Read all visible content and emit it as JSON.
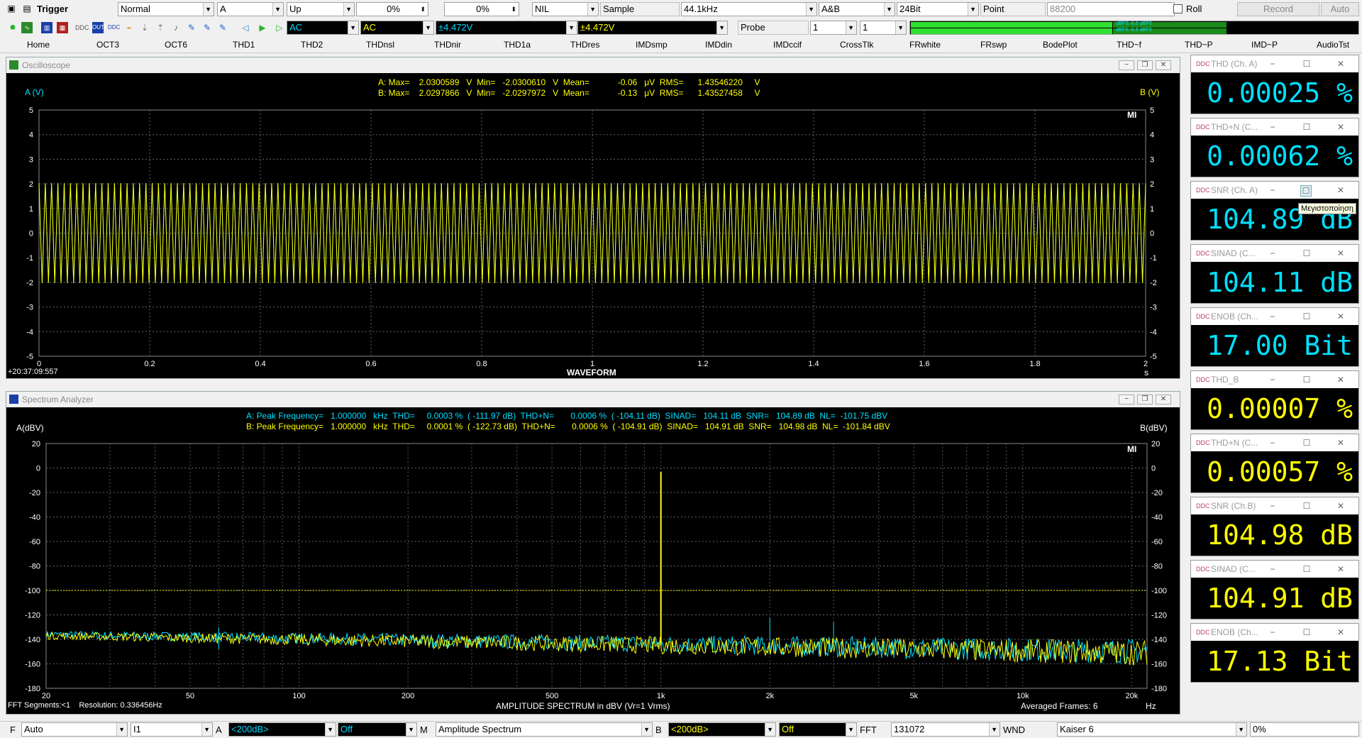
{
  "toolbar1": {
    "trigger_label": "Trigger",
    "mode": "Normal",
    "channel": "A",
    "edge": "Up",
    "level1": "0%",
    "level2": "0%",
    "nil": "NIL",
    "sample_label": "Sample",
    "sample_rate": "44.1kHz",
    "ab": "A&B",
    "bits": "24Bit",
    "point_label": "Point",
    "point_value": "88200",
    "roll_label": "Roll",
    "record_label": "Record",
    "auto_label": "Auto"
  },
  "toolbar2": {
    "coupling_a": "AC",
    "coupling_b": "AC",
    "range_a": "±4.472V",
    "range_b": "±4.472V",
    "probe_label": "Probe",
    "probe_a": "1",
    "probe_b": "1",
    "level_meter_text": "dBFS:-6.6 dBFS\ndBFS:-6.6 dBFS"
  },
  "tabs": [
    "Home",
    "OCT3",
    "OCT6",
    "THD1",
    "THD2",
    "THDnsl",
    "THDnir",
    "THD1a",
    "THDres",
    "IMDsmp",
    "IMDdin",
    "IMDccif",
    "CrossTlk",
    "FRwhite",
    "FRswp",
    "BodePlot",
    "THD~f",
    "THD~P",
    "IMD~P",
    "AudioTst"
  ],
  "oscilloscope": {
    "title": "Oscilloscope",
    "left_axis_label": "A (V)",
    "right_axis_label": "B (V)",
    "meas_a": "A: Max=    2.0300589   V  Min=   -2.0300610   V  Mean=            -0.06   μV  RMS=      1.43546220     V",
    "meas_b": "B: Max=    2.0297866   V  Min=   -2.0297972   V  Mean=            -0.13   μV  RMS=      1.43527458     V",
    "timestamp": "+20:37:09:557",
    "x_caption": "WAVEFORM",
    "x_unit": "s",
    "corner_mark": "MI",
    "y_ticks": [
      "5",
      "4",
      "3",
      "2",
      "1",
      "0",
      "-1",
      "-2",
      "-3",
      "-4",
      "-5"
    ],
    "x_ticks": [
      "0",
      "0.2",
      "0.4",
      "0.6",
      "0.8",
      "1",
      "1.2",
      "1.4",
      "1.6",
      "1.8",
      "2"
    ]
  },
  "spectrum": {
    "title": "Spectrum Analyzer",
    "left_axis_label": "A(dBV)",
    "right_axis_label": "B(dBV)",
    "meas_a": "A: Peak Frequency=   1.000000   kHz  THD=     0.0003 %  ( -111.97 dB)  THD+N=       0.0006 %  ( -104.11 dB)  SINAD=   104.11 dB  SNR=   104.89 dB  NL=  -101.75 dBV",
    "meas_b": "B: Peak Frequency=   1.000000   kHz  THD=     0.0001 %  ( -122.73 dB)  THD+N=       0.0006 %  ( -104.91 dB)  SINAD=   104.91 dB  SNR=   104.98 dB  NL=  -101.84 dBV",
    "footer_left": "FFT Segments:<1    Resolution: 0.336456Hz",
    "footer_center": "AMPLITUDE SPECTRUM in dBV (Vr=1 Vrms)",
    "footer_right": "Averaged Frames: 6",
    "x_unit": "Hz",
    "corner_mark": "MI",
    "y_ticks": [
      "20",
      "0",
      "-20",
      "-40",
      "-60",
      "-80",
      "-100",
      "-120",
      "-140",
      "-160",
      "-180"
    ],
    "x_ticks": [
      "20",
      "50",
      "100",
      "200",
      "500",
      "1k",
      "2k",
      "5k",
      "10k",
      "20k"
    ]
  },
  "meters": [
    {
      "title": "THD (Ch. A)",
      "value": "0.00025 %",
      "color": "#00e0ff"
    },
    {
      "title": "THD+N (C...",
      "value": "0.00062 %",
      "color": "#00e0ff"
    },
    {
      "title": "SNR (Ch. A)",
      "value": "104.89 dB",
      "color": "#00e0ff"
    },
    {
      "title": "SINAD (C...",
      "value": "104.11 dB",
      "color": "#00e0ff"
    },
    {
      "title": "ENOB (Ch...",
      "value": "17.00 Bit",
      "color": "#00e0ff"
    },
    {
      "title": "THD_B",
      "value": "0.00007 %",
      "color": "#ffff00"
    },
    {
      "title": "THD+N (C...",
      "value": "0.00057 %",
      "color": "#ffff00"
    },
    {
      "title": "SNR (Ch.B)",
      "value": "104.98 dB",
      "color": "#ffff00"
    },
    {
      "title": "SINAD (C...",
      "value": "104.91 dB",
      "color": "#ffff00"
    },
    {
      "title": "ENOB (Ch...",
      "value": "17.13 Bit",
      "color": "#ffff00"
    }
  ],
  "tooltip": "Μεγιστοποίηση",
  "statusbar": {
    "f_label": "F",
    "f_value": "Auto",
    "i_value": "I1",
    "a_label": "A",
    "a_range": "<200dB>",
    "a_off": "Off",
    "m_label": "M",
    "m_value": "Amplitude Spectrum",
    "b_label": "B",
    "b_range": "<200dB>",
    "b_off": "Off",
    "fft_label": "FFT",
    "fft_value": "131072",
    "wnd_label": "WND",
    "wnd_value": "Kaiser 6",
    "pct": "0%"
  },
  "colors": {
    "channel_a": "#00e0ff",
    "channel_b": "#ffff00",
    "grid": "#6e6e6e",
    "background": "#000000"
  }
}
